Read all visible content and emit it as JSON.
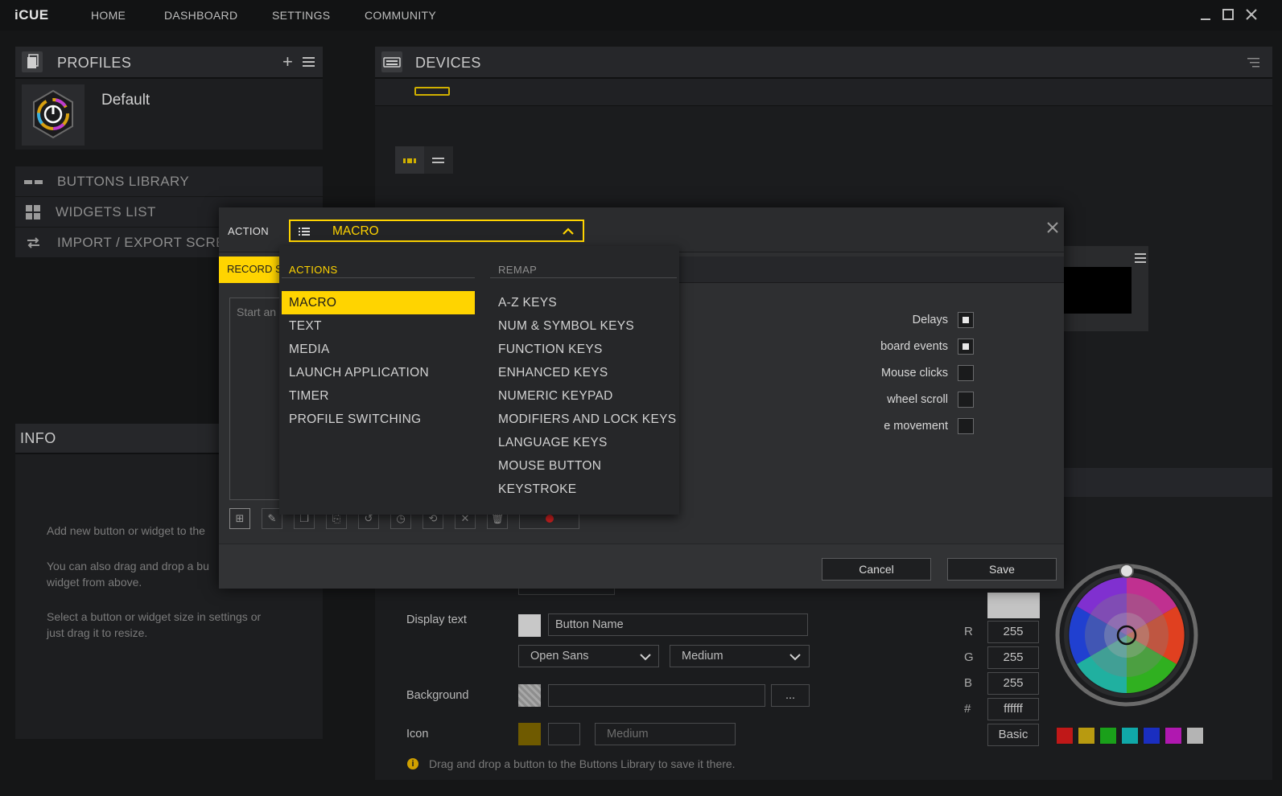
{
  "app": {
    "title": "iCUE"
  },
  "nav": {
    "home": "HOME",
    "dashboard": "DASHBOARD",
    "settings": "SETTINGS",
    "community": "COMMUNITY"
  },
  "profiles": {
    "title": "PROFILES",
    "default_name": "Default"
  },
  "sidebar": {
    "buttons_library": "BUTTONS LIBRARY",
    "widgets_list": "WIDGETS LIST",
    "import_export": "IMPORT / EXPORT SCREE"
  },
  "info": {
    "title": "INFO",
    "line1": "Add new button or widget to the",
    "line2a": "You can also drag and drop a bu",
    "line2b": "widget from above.",
    "line3a": "Select a button or widget size in settings or",
    "line3b": "just drag it to resize."
  },
  "devices": {
    "title": "DEVICES"
  },
  "dialog": {
    "action_label": "ACTION",
    "selected_action": "MACRO",
    "record_tab": "RECORD S",
    "placeholder": "Start an",
    "cancel": "Cancel",
    "save": "Save",
    "checks": [
      {
        "label": "Delays",
        "checked": true
      },
      {
        "label": "board events",
        "checked": true
      },
      {
        "label": "Mouse clicks",
        "checked": false
      },
      {
        "label": "wheel scroll",
        "checked": false
      },
      {
        "label": "e movement",
        "checked": false
      }
    ]
  },
  "dropdown": {
    "actions_header": "ACTIONS",
    "remap_header": "REMAP",
    "actions": [
      "MACRO",
      "TEXT",
      "MEDIA",
      "LAUNCH APPLICATION",
      "TIMER",
      "PROFILE SWITCHING"
    ],
    "remap": [
      "A-Z KEYS",
      "NUM & SYMBOL KEYS",
      "FUNCTION KEYS",
      "ENHANCED KEYS",
      "NUMERIC KEYPAD",
      "MODIFIERS AND LOCK KEYS",
      "LANGUAGE KEYS",
      "MOUSE BUTTON",
      "KEYSTROKE"
    ]
  },
  "properties": {
    "display_text_label": "Display text",
    "display_text_value": "Button Name",
    "font": "Open Sans",
    "weight": "Medium",
    "background_label": "Background",
    "ellipsis": "...",
    "icon_label": "Icon",
    "icon_size": "Medium",
    "hint": "Drag and drop a button to the Buttons Library to save it there."
  },
  "color": {
    "r_label": "R",
    "g_label": "G",
    "b_label": "B",
    "hex_label": "#",
    "r": "255",
    "g": "255",
    "b": "255",
    "hex": "ffffff",
    "basic": "Basic",
    "presets": [
      "#c01818",
      "#b89a10",
      "#1aa01a",
      "#10a8a8",
      "#1a2ec0",
      "#b018b0",
      "#b4b4b4"
    ]
  },
  "colors": {
    "accent": "#ffd400",
    "icon_swatch": "#6f5a00"
  }
}
